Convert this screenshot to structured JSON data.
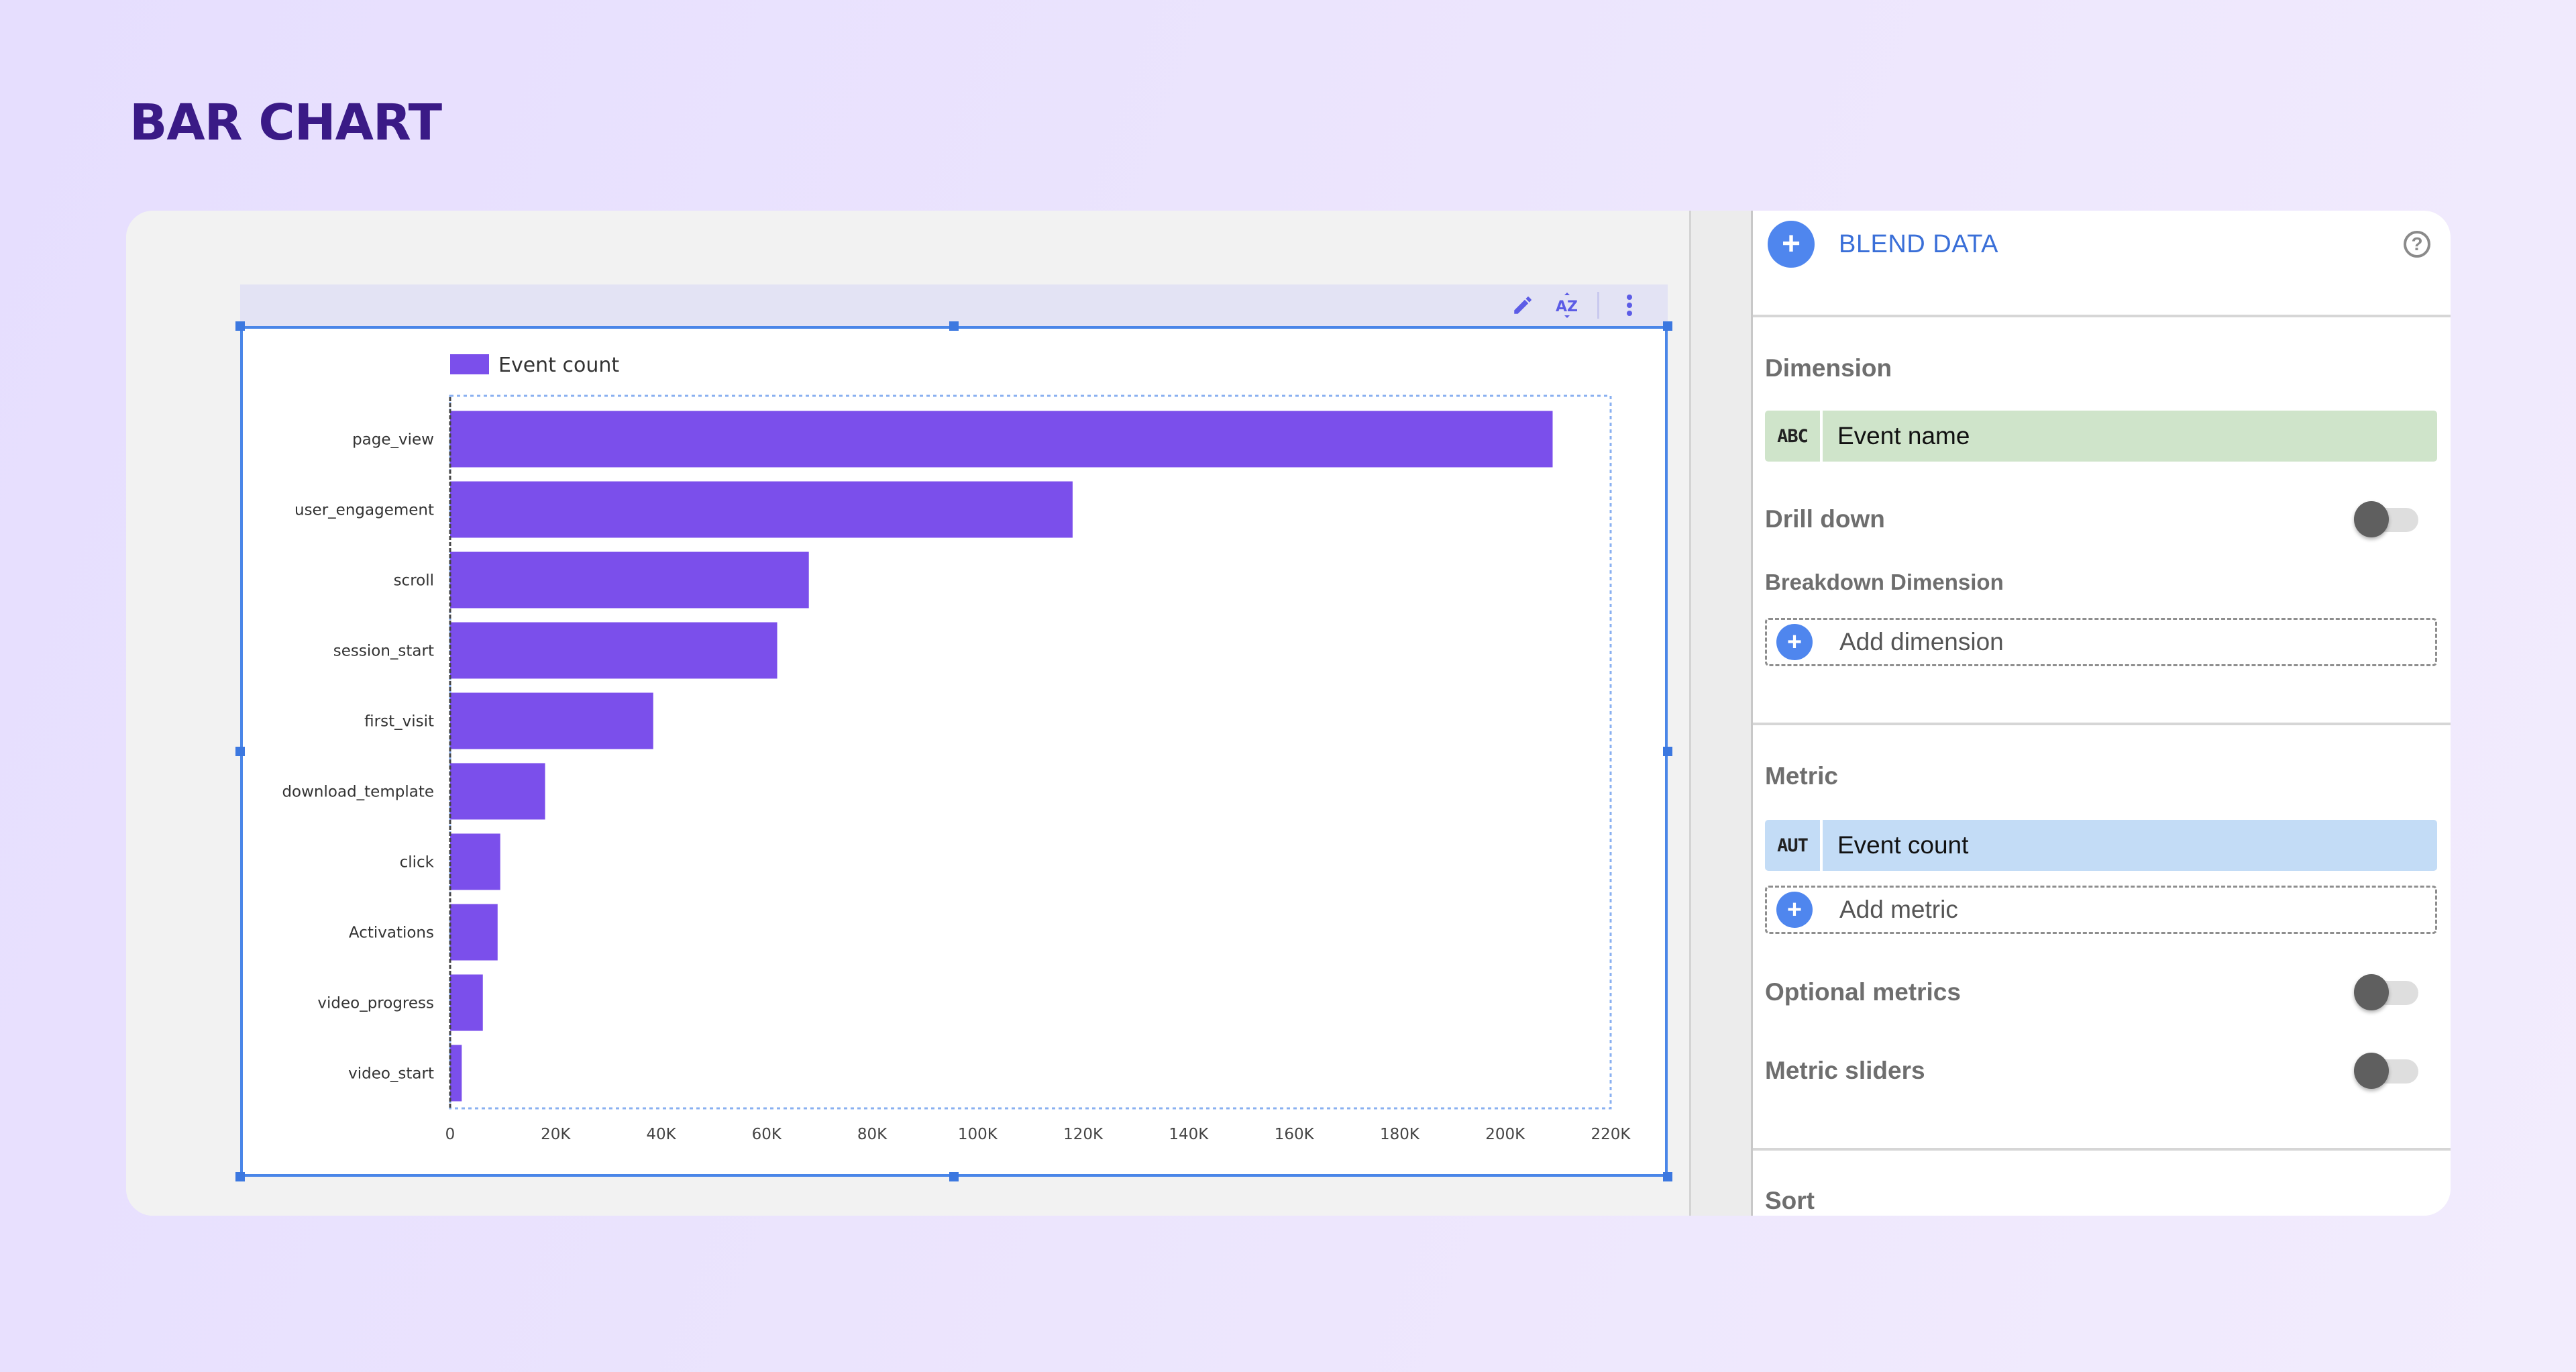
{
  "page": {
    "title": "BAR CHART"
  },
  "toolbar": {
    "icons": [
      "pencil-icon",
      "sort-az-icon",
      "more-vert-icon"
    ],
    "sort_label": "AZ"
  },
  "chart_data": {
    "type": "bar",
    "orientation": "horizontal",
    "title": "",
    "xlabel": "",
    "ylabel": "",
    "categories": [
      "page_view",
      "user_engagement",
      "scroll",
      "session_start",
      "first_visit",
      "download_template",
      "click",
      "Activations",
      "video_progress",
      "video_start"
    ],
    "series": [
      {
        "name": "Event count",
        "color": "#7b4feb",
        "values": [
          209000,
          118000,
          68000,
          62000,
          38500,
          18000,
          9500,
          9000,
          6200,
          2200
        ]
      }
    ],
    "xlim": [
      0,
      220000
    ],
    "x_ticks": [
      0,
      20000,
      40000,
      60000,
      80000,
      100000,
      120000,
      140000,
      160000,
      180000,
      200000,
      220000
    ],
    "x_tick_labels": [
      "0",
      "20K",
      "40K",
      "60K",
      "80K",
      "100K",
      "120K",
      "140K",
      "160K",
      "180K",
      "200K",
      "220K"
    ],
    "grid": false,
    "legend": {
      "position": "top-left",
      "entries": [
        "Event count"
      ]
    }
  },
  "panel": {
    "blend_label": "BLEND DATA",
    "help_icon": "help-circle-icon",
    "dimension": {
      "title": "Dimension",
      "chip_type": "ABC",
      "chip_label": "Event name",
      "chip_color": "#cfe4ca"
    },
    "drill_down": {
      "label": "Drill down",
      "enabled": false
    },
    "breakdown": {
      "title": "Breakdown Dimension",
      "add_label": "Add dimension"
    },
    "metric": {
      "title": "Metric",
      "chip_type": "AUT",
      "chip_label": "Event count",
      "chip_color": "#c3dcf6",
      "add_label": "Add metric"
    },
    "optional_metrics": {
      "label": "Optional metrics",
      "enabled": false
    },
    "metric_sliders": {
      "label": "Metric sliders",
      "enabled": false
    },
    "sort": {
      "title": "Sort"
    }
  },
  "colors": {
    "accent": "#4f86ee",
    "bar": "#7b4feb",
    "title": "#3a1a86",
    "selection": "#4a86e8"
  }
}
